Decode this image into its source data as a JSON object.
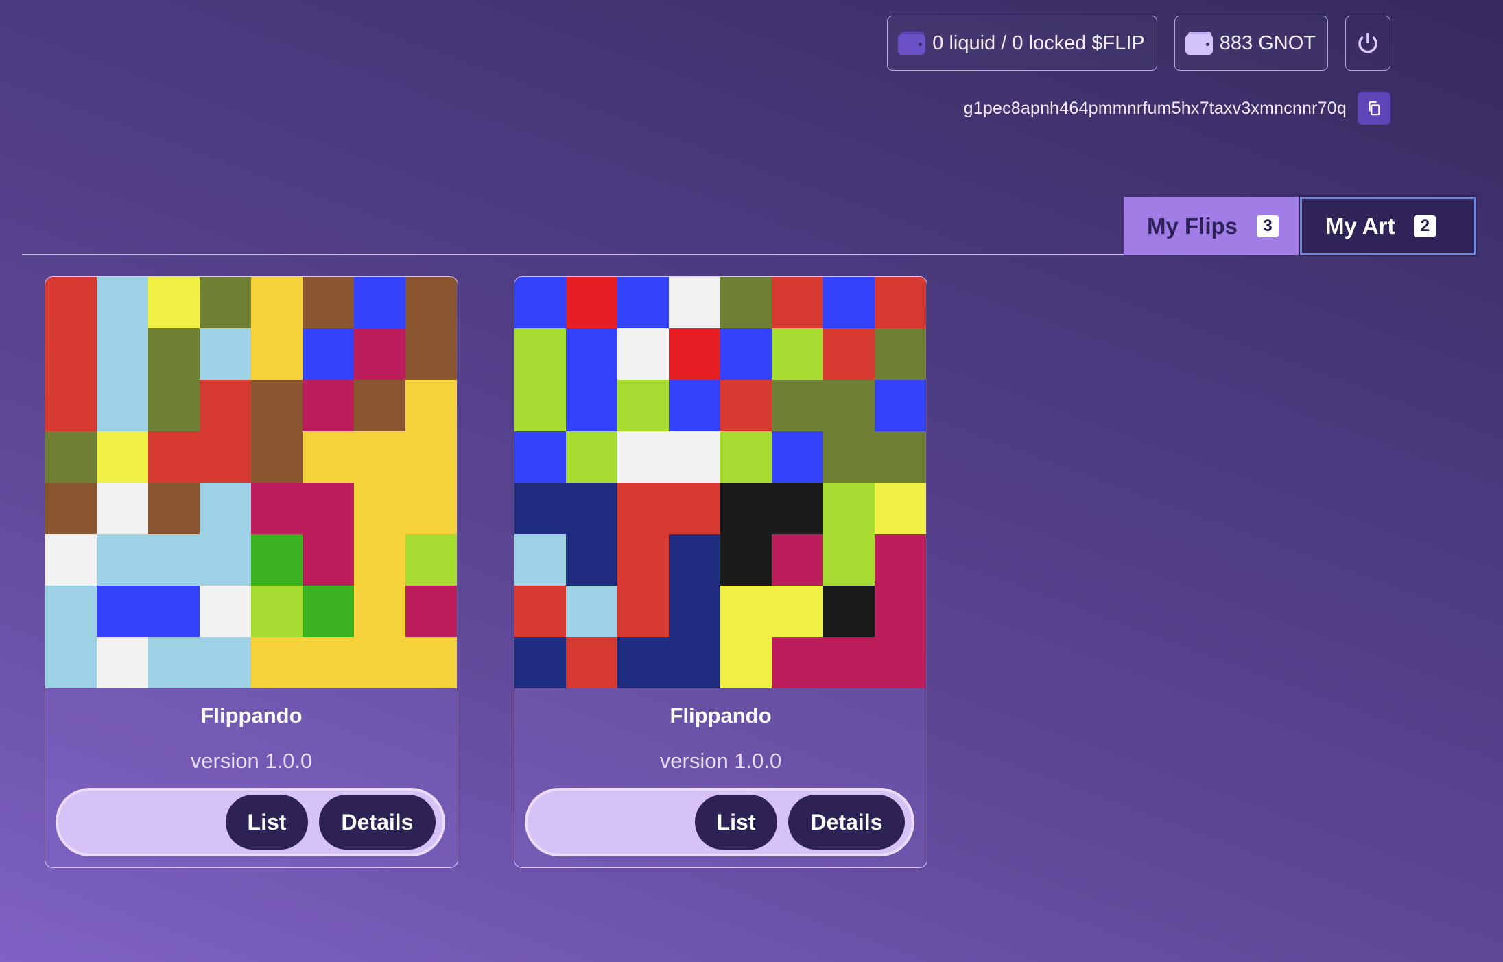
{
  "header": {
    "flip_balance": "0 liquid / 0 locked $FLIP",
    "gnot_balance": "883 GNOT",
    "address": "g1pec8apnh464pmmnrfum5hx7taxv3xmncnnr70q"
  },
  "tabs": [
    {
      "label": "My Flips",
      "count": "3",
      "active": false
    },
    {
      "label": "My Art",
      "count": "2",
      "active": true
    }
  ],
  "palette": {
    "R": "#d63a31",
    "L": "#9dd1e5",
    "Y": "#f0f044",
    "O": "#6f8035",
    "G": "#f5d23a",
    "N": "#8a5630",
    "B": "#3443fa",
    "M": "#bc1e5c",
    "W": "#f2f2f2",
    "K": "#3bb21f",
    "A": "#a6dc30",
    "D": "#1e2d80",
    "E": "#1a1a1a",
    "C": "#e81e25"
  },
  "cards": [
    {
      "title": "Flippando",
      "version": "version 1.0.0",
      "list_label": "List",
      "details_label": "Details",
      "grid": [
        "RLYOGNBN",
        "RLOLGBMN",
        "RLORNMNG",
        "OYRRNGGG",
        "NWNLMMGG",
        "WLLLKMGA",
        "LBBWAKGM",
        "LWLLGGGG"
      ]
    },
    {
      "title": "Flippando",
      "version": "version 1.0.0",
      "list_label": "List",
      "details_label": "Details",
      "grid": [
        "BCBWORBR",
        "ABWCBARO",
        "ABABROOB",
        "BAWWABOO",
        "DDRREEAY",
        "LDRDEMAM",
        "RLRDYYEM",
        "DRDDYMMM"
      ]
    }
  ]
}
